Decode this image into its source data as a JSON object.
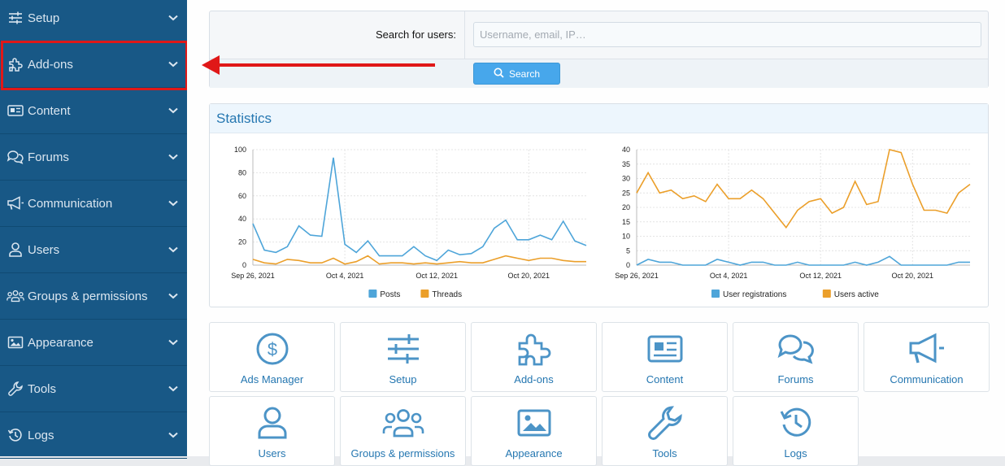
{
  "sidebar": {
    "items": [
      {
        "label": "Setup",
        "icon": "sliders-icon"
      },
      {
        "label": "Add-ons",
        "icon": "puzzle-icon"
      },
      {
        "label": "Content",
        "icon": "newspaper-icon"
      },
      {
        "label": "Forums",
        "icon": "comments-icon"
      },
      {
        "label": "Communication",
        "icon": "megaphone-icon"
      },
      {
        "label": "Users",
        "icon": "user-icon"
      },
      {
        "label": "Groups & permissions",
        "icon": "users-icon"
      },
      {
        "label": "Appearance",
        "icon": "image-icon"
      },
      {
        "label": "Tools",
        "icon": "wrench-icon"
      },
      {
        "label": "Logs",
        "icon": "history-icon"
      }
    ]
  },
  "search": {
    "label": "Search for users:",
    "placeholder": "Username, email, IP…",
    "button_label": "Search"
  },
  "statistics": {
    "title": "Statistics"
  },
  "colors": {
    "sidebar_bg": "#185886",
    "accent": "#47a7eb",
    "series_blue": "#4ea5d9",
    "series_orange": "#eb9f2a",
    "highlight": "#e01818"
  },
  "chart_data": [
    {
      "type": "line",
      "x": [
        "Sep 26, 2021",
        "Sep 27, 2021",
        "Sep 28, 2021",
        "Sep 29, 2021",
        "Sep 30, 2021",
        "Oct 1, 2021",
        "Oct 2, 2021",
        "Oct 3, 2021",
        "Oct 4, 2021",
        "Oct 5, 2021",
        "Oct 6, 2021",
        "Oct 7, 2021",
        "Oct 8, 2021",
        "Oct 9, 2021",
        "Oct 10, 2021",
        "Oct 11, 2021",
        "Oct 12, 2021",
        "Oct 13, 2021",
        "Oct 14, 2021",
        "Oct 15, 2021",
        "Oct 16, 2021",
        "Oct 17, 2021",
        "Oct 18, 2021",
        "Oct 19, 2021",
        "Oct 20, 2021",
        "Oct 21, 2021",
        "Oct 22, 2021",
        "Oct 23, 2021",
        "Oct 24, 2021",
        "Oct 25, 2021"
      ],
      "x_tick_labels": [
        "Sep 26, 2021",
        "Oct 4, 2021",
        "Oct 12, 2021",
        "Oct 20, 2021"
      ],
      "y_ticks": [
        0,
        20,
        40,
        60,
        80,
        100
      ],
      "ylim": [
        0,
        100
      ],
      "series": [
        {
          "name": "Posts",
          "color": "#4ea5d9",
          "values": [
            36,
            13,
            11,
            16,
            34,
            26,
            25,
            93,
            18,
            11,
            21,
            8,
            8,
            8,
            16,
            8,
            4,
            13,
            9,
            10,
            16,
            32,
            39,
            22,
            22,
            26,
            22,
            38,
            21,
            17
          ]
        },
        {
          "name": "Threads",
          "color": "#eb9f2a",
          "values": [
            5,
            2,
            1,
            5,
            4,
            2,
            2,
            6,
            1,
            3,
            8,
            1,
            2,
            2,
            1,
            2,
            1,
            2,
            3,
            2,
            2,
            5,
            8,
            6,
            4,
            6,
            6,
            4,
            3,
            3
          ]
        }
      ],
      "grid": true,
      "legend": "bottom"
    },
    {
      "type": "line",
      "x": [
        "Sep 26, 2021",
        "Sep 27, 2021",
        "Sep 28, 2021",
        "Sep 29, 2021",
        "Sep 30, 2021",
        "Oct 1, 2021",
        "Oct 2, 2021",
        "Oct 3, 2021",
        "Oct 4, 2021",
        "Oct 5, 2021",
        "Oct 6, 2021",
        "Oct 7, 2021",
        "Oct 8, 2021",
        "Oct 9, 2021",
        "Oct 10, 2021",
        "Oct 11, 2021",
        "Oct 12, 2021",
        "Oct 13, 2021",
        "Oct 14, 2021",
        "Oct 15, 2021",
        "Oct 16, 2021",
        "Oct 17, 2021",
        "Oct 18, 2021",
        "Oct 19, 2021",
        "Oct 20, 2021",
        "Oct 21, 2021",
        "Oct 22, 2021",
        "Oct 23, 2021",
        "Oct 24, 2021",
        "Oct 25, 2021"
      ],
      "x_tick_labels": [
        "Sep 26, 2021",
        "Oct 4, 2021",
        "Oct 12, 2021",
        "Oct 20, 2021"
      ],
      "y_ticks": [
        0,
        5,
        10,
        15,
        20,
        25,
        30,
        35,
        40
      ],
      "ylim": [
        0,
        40
      ],
      "series": [
        {
          "name": "User registrations",
          "color": "#4ea5d9",
          "values": [
            0,
            2,
            1,
            1,
            0,
            0,
            0,
            2,
            1,
            0,
            1,
            1,
            0,
            0,
            1,
            0,
            0,
            0,
            0,
            1,
            0,
            1,
            3,
            0,
            0,
            0,
            0,
            0,
            1,
            1
          ]
        },
        {
          "name": "Users active",
          "color": "#eb9f2a",
          "values": [
            25,
            32,
            25,
            26,
            23,
            24,
            22,
            28,
            23,
            23,
            26,
            23,
            18,
            13,
            19,
            22,
            23,
            18,
            20,
            29,
            21,
            22,
            40,
            39,
            28,
            19,
            19,
            18,
            25,
            28
          ]
        }
      ],
      "grid": true,
      "legend": "bottom"
    }
  ],
  "tiles": [
    {
      "label": "Ads Manager",
      "icon": "dollar-circle-icon"
    },
    {
      "label": "Setup",
      "icon": "sliders-icon"
    },
    {
      "label": "Add-ons",
      "icon": "puzzle-icon"
    },
    {
      "label": "Content",
      "icon": "newspaper-icon"
    },
    {
      "label": "Forums",
      "icon": "comments-icon"
    },
    {
      "label": "Communication",
      "icon": "megaphone-icon"
    },
    {
      "label": "Users",
      "icon": "user-icon"
    },
    {
      "label": "Groups & permissions",
      "icon": "users-icon"
    },
    {
      "label": "Appearance",
      "icon": "image-icon"
    },
    {
      "label": "Tools",
      "icon": "wrench-icon"
    },
    {
      "label": "Logs",
      "icon": "history-icon"
    }
  ]
}
